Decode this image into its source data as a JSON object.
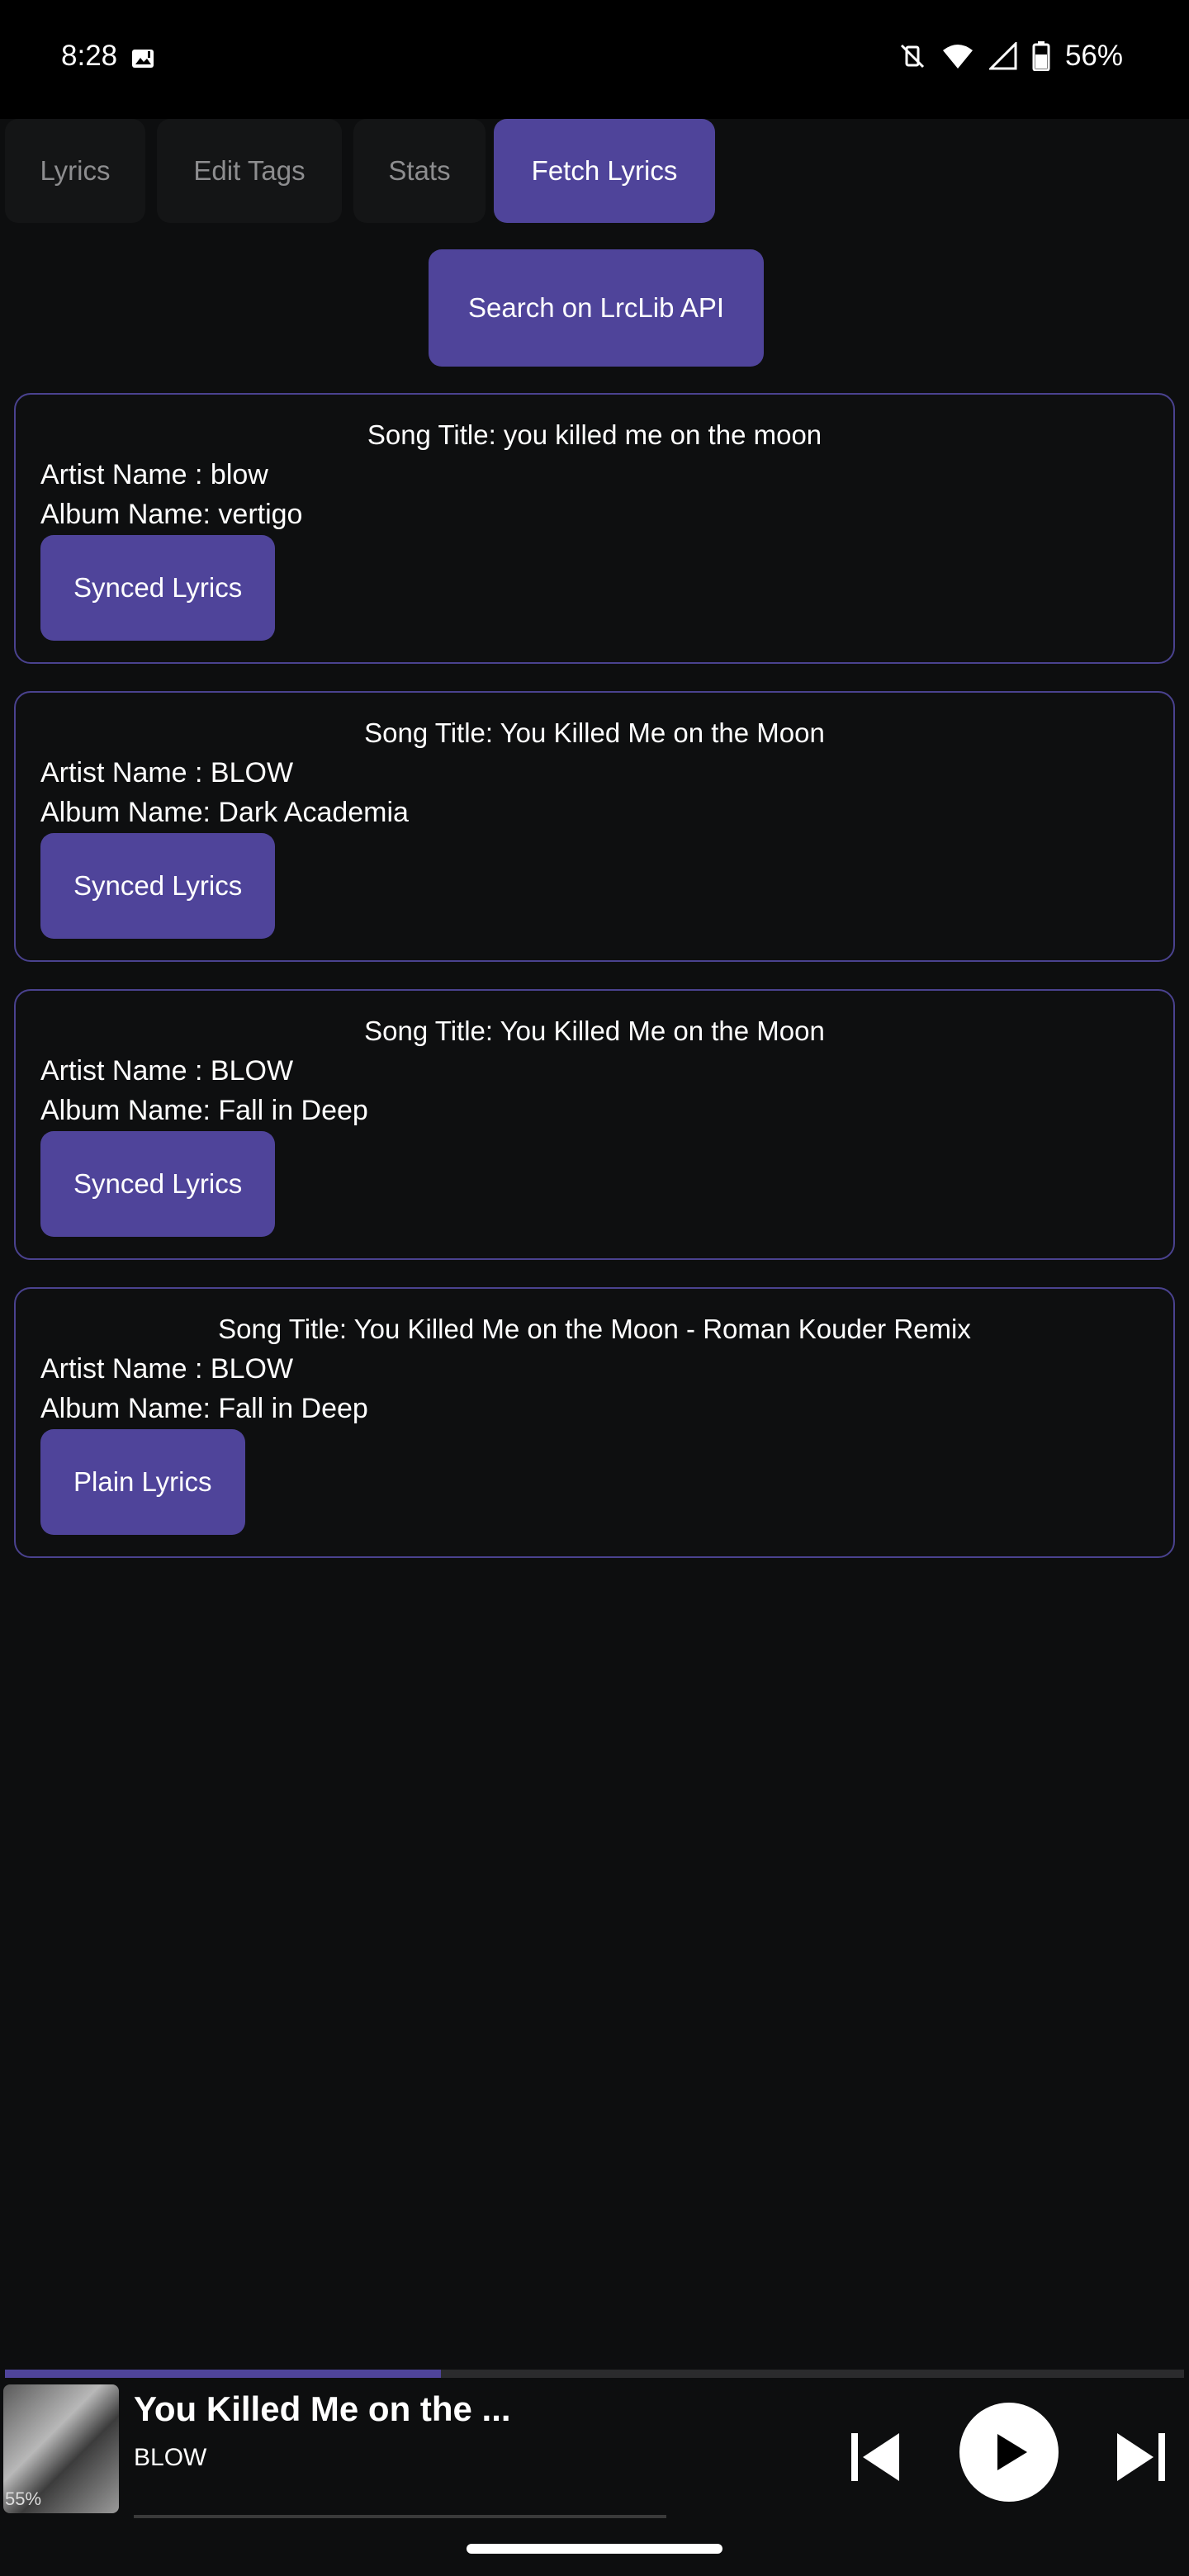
{
  "status_bar": {
    "time": "8:28",
    "battery": "56%",
    "icons": [
      "photo-icon",
      "mute-vibrate-icon",
      "wifi-icon",
      "signal-icon",
      "battery-icon"
    ]
  },
  "tabs": [
    {
      "label": "Lyrics",
      "active": false
    },
    {
      "label": "Edit Tags",
      "active": false
    },
    {
      "label": "Stats",
      "active": false
    },
    {
      "label": "Fetch Lyrics",
      "active": true
    }
  ],
  "search_button": "Search on LrcLib API",
  "results": [
    {
      "title": "Song Title: you killed me on the moon",
      "artist": "Artist Name : blow",
      "album": "Album Name: vertigo",
      "button": "Synced Lyrics"
    },
    {
      "title": "Song Title: You Killed Me on the Moon",
      "artist": "Artist Name : BLOW",
      "album": "Album Name: Dark Academia",
      "button": "Synced Lyrics"
    },
    {
      "title": "Song Title: You Killed Me on the Moon",
      "artist": "Artist Name : BLOW",
      "album": "Album Name: Fall in Deep",
      "button": "Synced Lyrics"
    },
    {
      "title": "Song Title: You Killed Me on the Moon - Roman Kouder Remix",
      "artist": "Artist Name : BLOW",
      "album": "Album Name: Fall in Deep",
      "button": "Plain Lyrics"
    }
  ],
  "player": {
    "title": "You Killed Me on the ...",
    "artist": "BLOW",
    "art_label": "55%",
    "progress": 0.37,
    "accent": "#4f449a"
  },
  "colors": {
    "accent": "#4f449a",
    "background": "#0d0e0f",
    "card_border": "#4a428f"
  }
}
